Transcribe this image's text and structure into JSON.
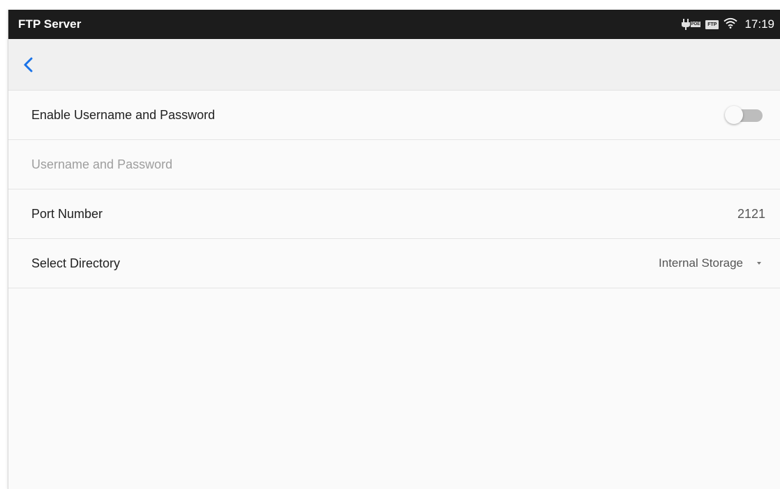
{
  "status_bar": {
    "title": "FTP Server",
    "ftp_badge": "FTP",
    "poe_tag": "POE",
    "time": "17:19"
  },
  "settings": {
    "enable_auth": {
      "label": "Enable Username and Password",
      "toggle_on": false
    },
    "credentials": {
      "label": "Username and Password",
      "enabled": false
    },
    "port": {
      "label": "Port Number",
      "value": "2121"
    },
    "directory": {
      "label": "Select Directory",
      "value": "Internal Storage"
    }
  },
  "colors": {
    "accent": "#1a73e8",
    "status_bar_bg": "#1c1c1c",
    "toggle_track_off": "#bdbdbd"
  }
}
